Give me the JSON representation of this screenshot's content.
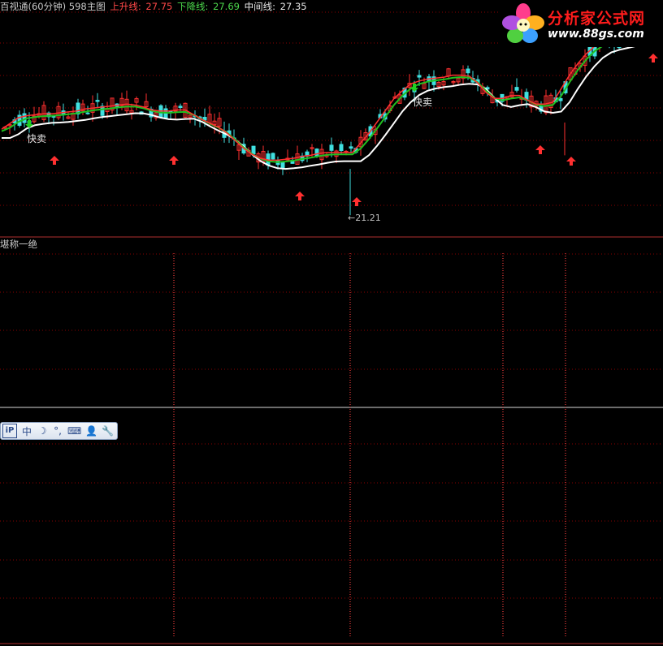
{
  "header": {
    "title": "百视通(60分钟) 598主图",
    "up_label": "上升线: ",
    "up_value": "27.75",
    "down_label": "下降线: ",
    "down_value": "27.69",
    "mid_label": "中间线: ",
    "mid_value": "27.35"
  },
  "subpanel": {
    "title": "堪称一绝"
  },
  "logo": {
    "name": "分析家公式网",
    "url": "www.88gs.com"
  },
  "ime_toolbar": {
    "logo": "iP",
    "mode": "中",
    "half_width": "☽",
    "punct": "°,",
    "keyboard": "⌨",
    "user": "👤",
    "tool": "🔧"
  },
  "annotations": {
    "sell1": "快卖",
    "sell2": "快卖",
    "low_price": "←21.21"
  },
  "colors": {
    "up_candle": "#ff3030",
    "down_candle": "#40e0e0",
    "up_line": "#ff3030",
    "down_line": "#20c020",
    "mid_line": "#ffffff",
    "grid": "#8b0000",
    "buy_arrow": "#ff3030",
    "sell_arrow": "#20d020"
  },
  "chart_data": {
    "type": "candlestick",
    "title": "百视通(60分钟) 598主图",
    "series": [
      {
        "name": "上升线",
        "last": 27.75
      },
      {
        "name": "下降线",
        "last": 27.69
      },
      {
        "name": "中间线",
        "last": 27.35
      }
    ],
    "annotations": [
      {
        "text": "快卖",
        "kind": "sell-signal"
      },
      {
        "text": "快卖",
        "kind": "sell-signal"
      },
      {
        "text": "←21.21",
        "kind": "low-price"
      }
    ],
    "mid_path": [
      25.2,
      25.5,
      25.8,
      25.9,
      25.95,
      26.0,
      26.0,
      26.05,
      26.1,
      26.15,
      26.25,
      26.3,
      26.35,
      26.4,
      26.45,
      26.5,
      26.45,
      26.35,
      26.2,
      26.15,
      26.15,
      26.2,
      26.2,
      25.95,
      25.7,
      25.5,
      25.3,
      25.0,
      24.6,
      24.2,
      23.9,
      23.7,
      23.6,
      23.6,
      23.65,
      23.7,
      23.8,
      23.85,
      23.95,
      24.0,
      24.0,
      24.0,
      24.0,
      24.5,
      25.0,
      25.6,
      26.2,
      26.8,
      27.2,
      27.55,
      27.7,
      27.8,
      27.85,
      27.9,
      28.0,
      28.0,
      27.95,
      27.6,
      27.1,
      26.8,
      26.8,
      26.95,
      26.95,
      26.7,
      26.5,
      26.5,
      26.6,
      27.3,
      28.0,
      28.6,
      29.1,
      29.5,
      29.7,
      29.8,
      29.9,
      30.0,
      30.1,
      30.2,
      30.3,
      30.35
    ],
    "y_range": [
      21.0,
      31.5
    ]
  }
}
